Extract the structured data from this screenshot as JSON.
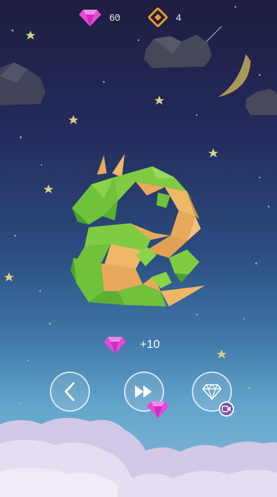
{
  "hud": {
    "gems": "60",
    "tokens": "4",
    "gem_icon": "pink-gem-icon",
    "token_icon": "orange-diamond-token-icon"
  },
  "reward": {
    "amount": "+10",
    "icon": "pink-gem-icon"
  },
  "controls": [
    {
      "name": "back",
      "icon": "chevron-left-icon"
    },
    {
      "name": "skip",
      "icon": "fast-forward-icon"
    },
    {
      "name": "watch-video-for-gems",
      "icon": "diamond-outline-icon",
      "badge_icon": "video-camera-icon"
    }
  ],
  "colors": {
    "gem": "#e64ad6",
    "token": "#f29a2e",
    "dragon_green": "#6fc23a",
    "dragon_orange": "#e9a95a",
    "badge": "#7a4fb0"
  }
}
